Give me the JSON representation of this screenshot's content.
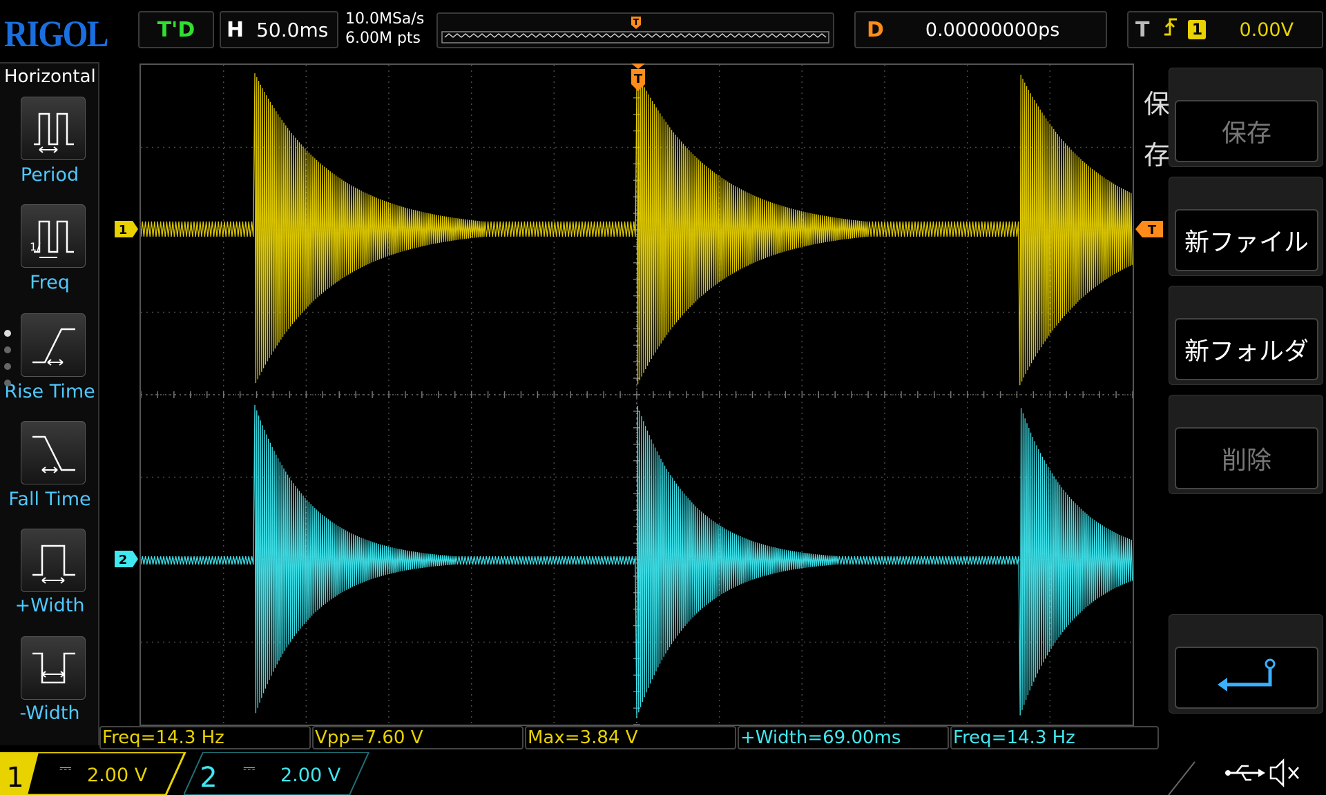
{
  "header": {
    "logo": "RIGOL",
    "run_status": "T'D",
    "timebase_letter": "H",
    "timebase": "50.0ms",
    "sample_rate": "10.0MSa/s",
    "memory_depth": "6.00M pts",
    "delay_letter": "D",
    "delay": "0.00000000ps",
    "trigger_letter": "T",
    "trigger_source": "1",
    "trigger_level": "0.00V"
  },
  "left_menu": {
    "title": "Horizontal",
    "items": [
      {
        "label": "Period"
      },
      {
        "label": "Freq"
      },
      {
        "label": "Rise Time"
      },
      {
        "label": "Fall Time"
      },
      {
        "label": "+Width"
      },
      {
        "label": "-Width"
      }
    ]
  },
  "right_menu": {
    "title_chars": [
      "保",
      "存"
    ],
    "buttons": [
      {
        "label": "保存",
        "enabled": false
      },
      {
        "label": "新ファイル",
        "enabled": true
      },
      {
        "label": "新フォルダ",
        "enabled": true
      },
      {
        "label": "削除",
        "enabled": false
      }
    ]
  },
  "measurements": [
    {
      "text": "Freq=14.3 Hz",
      "color": "#e8d200"
    },
    {
      "text": "Vpp=7.60 V",
      "color": "#e8d200"
    },
    {
      "text": "Max=3.84 V",
      "color": "#e8d200"
    },
    {
      "text": "+Width=69.00ms",
      "color": "#40e8f0"
    },
    {
      "text": "Freq=14.3 Hz",
      "color": "#40e8f0"
    }
  ],
  "channels": [
    {
      "number": "1",
      "coupling": "⎓",
      "scale": "2.00 V",
      "color": "#e8d200"
    },
    {
      "number": "2",
      "coupling": "⎓",
      "scale": "2.00 V",
      "color": "#40e8f0"
    }
  ],
  "markers": {
    "ch1": "1",
    "ch2": "2",
    "trigger": "T"
  },
  "colors": {
    "ch1": "#e8d200",
    "ch2": "#40e8f0",
    "trigger": "#ff8c1a",
    "menu_label": "#4fc8ff"
  },
  "icons": {
    "usb": "usb-icon",
    "speaker": "speaker-muted-icon",
    "back": "return-arrow-icon"
  }
}
